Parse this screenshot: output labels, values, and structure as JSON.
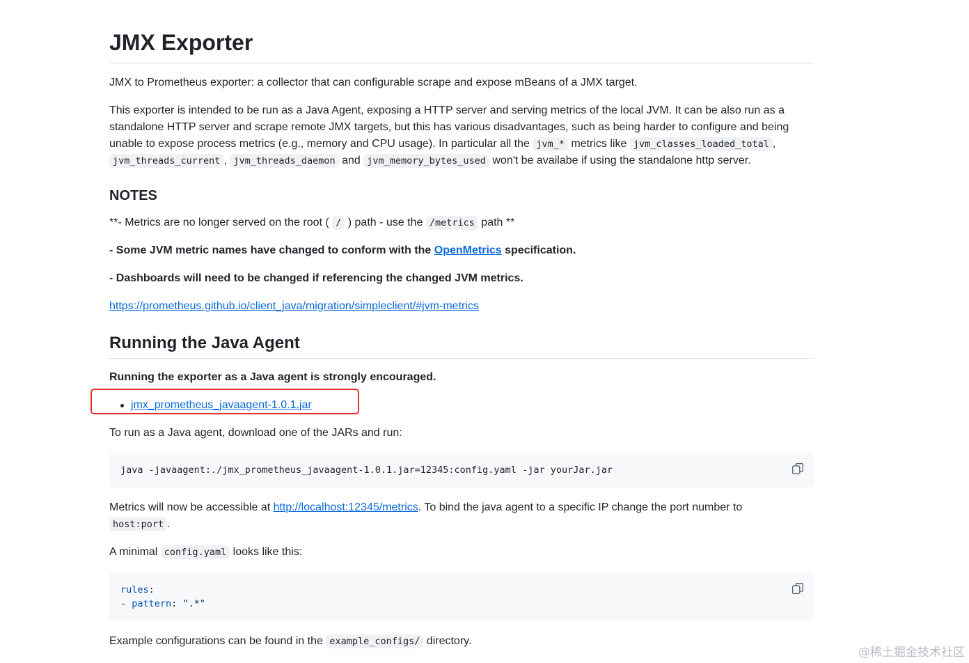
{
  "title": "JMX Exporter",
  "intro": "JMX to Prometheus exporter: a collector that can configurable scrape and expose mBeans of a JMX target.",
  "para2": {
    "text1": "This exporter is intended to be run as a Java Agent, exposing a HTTP server and serving metrics of the local JVM. It can be also run as a standalone HTTP server and scrape remote JMX targets, but this has various disadvantages, such as being harder to configure and being unable to expose process metrics (e.g., memory and CPU usage). In particular all the ",
    "code1": "jvm_*",
    "text2": " metrics like ",
    "code2": "jvm_classes_loaded_total",
    "text3": ", ",
    "code3": "jvm_threads_current",
    "text4": ", ",
    "code4": "jvm_threads_daemon",
    "text5": " and ",
    "code5": "jvm_memory_bytes_used",
    "text6": " won't be availabe if using the standalone http server."
  },
  "notes": {
    "heading": "NOTES",
    "line1": {
      "text1": "**- Metrics are no longer served on the root (",
      "code1": "/",
      "text2": ") path - use the ",
      "code2": "/metrics",
      "text3": " path **"
    },
    "line2": {
      "text1": "- Some JVM metric names have changed to conform with the ",
      "link": "OpenMetrics",
      "text2": " specification."
    },
    "line3": "- Dashboards will need to be changed if referencing the changed JVM metrics.",
    "migration_link": "https://prometheus.github.io/client_java/migration/simpleclient/#jvm-metrics"
  },
  "agent": {
    "heading": "Running the Java Agent",
    "encouraged": "Running the exporter as a Java agent is strongly encouraged.",
    "jar_link": "jmx_prometheus_javaagent-1.0.1.jar",
    "download_text": "To run as a Java agent, download one of the JARs and run:",
    "command": "java -javaagent:./jmx_prometheus_javaagent-1.0.1.jar=12345:config.yaml -jar yourJar.jar",
    "access": {
      "text1": "Metrics will now be accessible at ",
      "link": "http://localhost:12345/metrics",
      "text2": ". To bind the java agent to a specific IP change the port number to ",
      "code": "host:port",
      "text3": "."
    },
    "minimal": {
      "text1": "A minimal ",
      "code": "config.yaml",
      "text2": " looks like this:"
    },
    "yaml": {
      "key1": "rules",
      "colon": ":",
      "dash": "- ",
      "key2": "pattern",
      "sep": ": ",
      "value": "\".*\""
    },
    "example": {
      "text1": "Example configurations can be found in the ",
      "code": "example_configs/",
      "text2": " directory."
    }
  },
  "watermark": "@稀土掘金技术社区",
  "icons": {
    "copy": "copy-icon"
  },
  "colors": {
    "link": "#0969da",
    "highlight": "#e4332f",
    "code_bg": "#f6f8fa"
  }
}
